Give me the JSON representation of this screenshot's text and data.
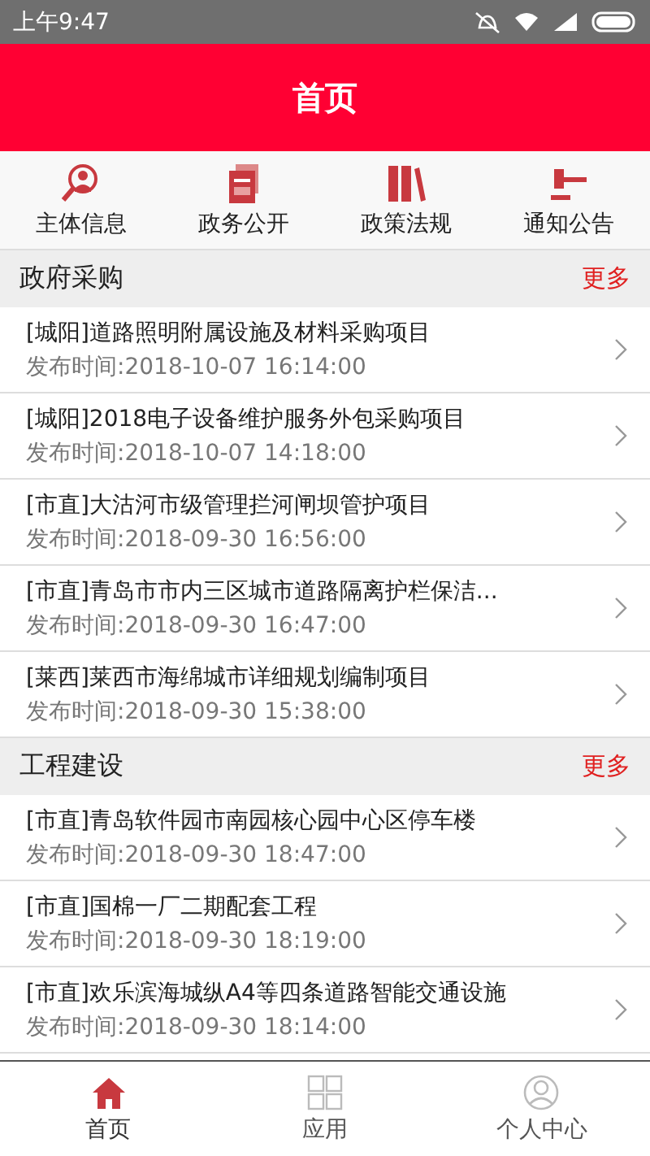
{
  "status_bar": {
    "time": "上午9:47"
  },
  "header": {
    "title": "首页"
  },
  "quick_nav": [
    {
      "kind": "person",
      "label": "主体信息"
    },
    {
      "kind": "document",
      "label": "政务公开"
    },
    {
      "kind": "books",
      "label": "政策法规"
    },
    {
      "kind": "gavel",
      "label": "通知公告"
    }
  ],
  "sections": [
    {
      "title": "政府采购",
      "more": "更多",
      "items": [
        {
          "title": "[城阳]道路照明附属设施及材料采购项目",
          "date": "发布时间:2018-10-07 16:14:00"
        },
        {
          "title": "[城阳]2018电子设备维护服务外包采购项目",
          "date": "发布时间:2018-10-07 14:18:00"
        },
        {
          "title": "[市直]大沽河市级管理拦河闸坝管护项目",
          "date": "发布时间:2018-09-30 16:56:00"
        },
        {
          "title": "[市直]青岛市市内三区城市道路隔离护栏保洁...",
          "date": "发布时间:2018-09-30 16:47:00"
        },
        {
          "title": "[莱西]莱西市海绵城市详细规划编制项目",
          "date": "发布时间:2018-09-30 15:38:00"
        }
      ]
    },
    {
      "title": "工程建设",
      "more": "更多",
      "items": [
        {
          "title": "[市直]青岛软件园市南园核心园中心区停车楼",
          "date": "发布时间:2018-09-30 18:47:00"
        },
        {
          "title": "[市直]国棉一厂二期配套工程",
          "date": "发布时间:2018-09-30 18:19:00"
        },
        {
          "title": "[市直]欢乐滨海城纵A4等四条道路智能交通设施",
          "date": "发布时间:2018-09-30 18:14:00"
        }
      ]
    }
  ],
  "tab_bar": [
    {
      "kind": "home",
      "label": "首页",
      "selected": true
    },
    {
      "kind": "apps",
      "label": "应用",
      "selected": false
    },
    {
      "kind": "user",
      "label": "个人中心",
      "selected": false
    }
  ]
}
